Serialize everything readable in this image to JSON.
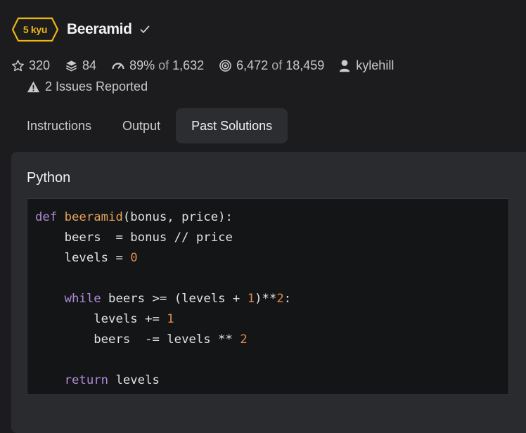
{
  "kata": {
    "rank": "5 kyu",
    "title": "Beeramid",
    "completed_icon": "check-icon"
  },
  "colors": {
    "rank": "#ecb613",
    "background": "#1c1c1e",
    "panel": "#2a2b2f",
    "code_background": "#141516",
    "keyword": "#b08ad8",
    "function_name": "#e6a15a",
    "number": "#e08a4c"
  },
  "stats": {
    "stars": "320",
    "collections": "84",
    "satisfaction_percent": "89%",
    "satisfaction_of": "of",
    "satisfaction_votes": "1,632",
    "completed": "6,472",
    "completed_of": "of",
    "attempts": "18,459",
    "author": "kylehill",
    "issues": "2 Issues Reported"
  },
  "tabs": [
    {
      "label": "Instructions",
      "active": false
    },
    {
      "label": "Output",
      "active": false
    },
    {
      "label": "Past Solutions",
      "active": true
    }
  ],
  "solution": {
    "language": "Python",
    "code": [
      [
        {
          "t": "def",
          "c": "kw"
        },
        {
          "t": " "
        },
        {
          "t": "beeramid",
          "c": "fn"
        },
        {
          "t": "(bonus, price):"
        }
      ],
      [
        {
          "t": "    beers  = bonus // price"
        }
      ],
      [
        {
          "t": "    levels = "
        },
        {
          "t": "0",
          "c": "num"
        }
      ],
      [],
      [
        {
          "t": "    "
        },
        {
          "t": "while",
          "c": "kw"
        },
        {
          "t": " beers >= (levels + "
        },
        {
          "t": "1",
          "c": "num"
        },
        {
          "t": ")**"
        },
        {
          "t": "2",
          "c": "num"
        },
        {
          "t": ":"
        }
      ],
      [
        {
          "t": "        levels += "
        },
        {
          "t": "1",
          "c": "num"
        }
      ],
      [
        {
          "t": "        beers  -= levels ** "
        },
        {
          "t": "2",
          "c": "num"
        }
      ],
      [],
      [
        {
          "t": "    "
        },
        {
          "t": "return",
          "c": "kw"
        },
        {
          "t": " levels"
        }
      ]
    ]
  }
}
